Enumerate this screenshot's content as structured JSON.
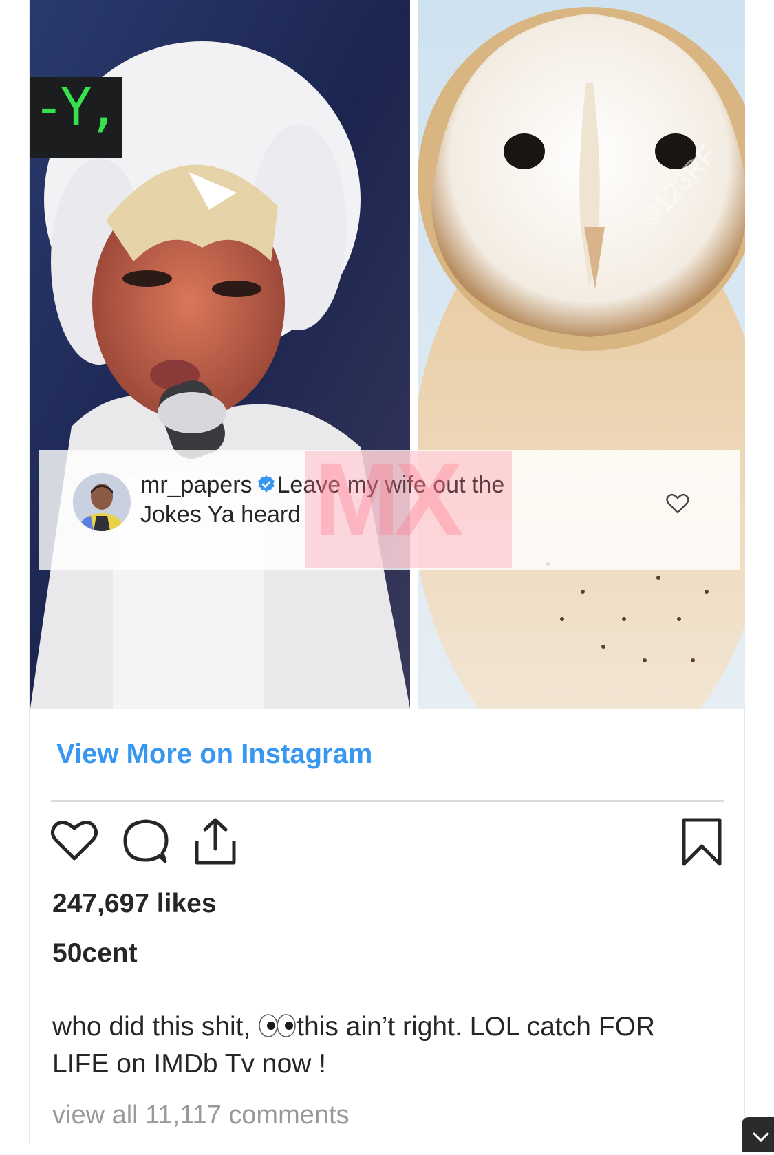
{
  "post": {
    "overlay_tag": "-Y,",
    "comment": {
      "username": "mr_papers",
      "text_line1": "Leave my wife out the",
      "text_line2": "Jokes Ya heard"
    },
    "watermark": "MX",
    "stock_watermark": "©123RF",
    "view_more_label": "View More on Instagram",
    "likes": "247,697 likes",
    "owner": "50cent",
    "caption_part1": "who did this shit, ",
    "caption_part2": "this ain’t right. LOL catch FOR LIFE on IMDb Tv now !",
    "view_all_comments": "view all 11,117 comments"
  },
  "colors": {
    "link": "#3897f0",
    "text": "#262626",
    "muted": "#999999",
    "verified": "#3897f0",
    "overlay_tag_text": "#38e24f"
  },
  "icons": {
    "like": "heart-outline-icon",
    "comment": "comment-bubble-icon",
    "share": "share-upload-icon",
    "save": "bookmark-icon",
    "verified": "verified-badge-icon",
    "comment_like": "small-heart-icon"
  }
}
